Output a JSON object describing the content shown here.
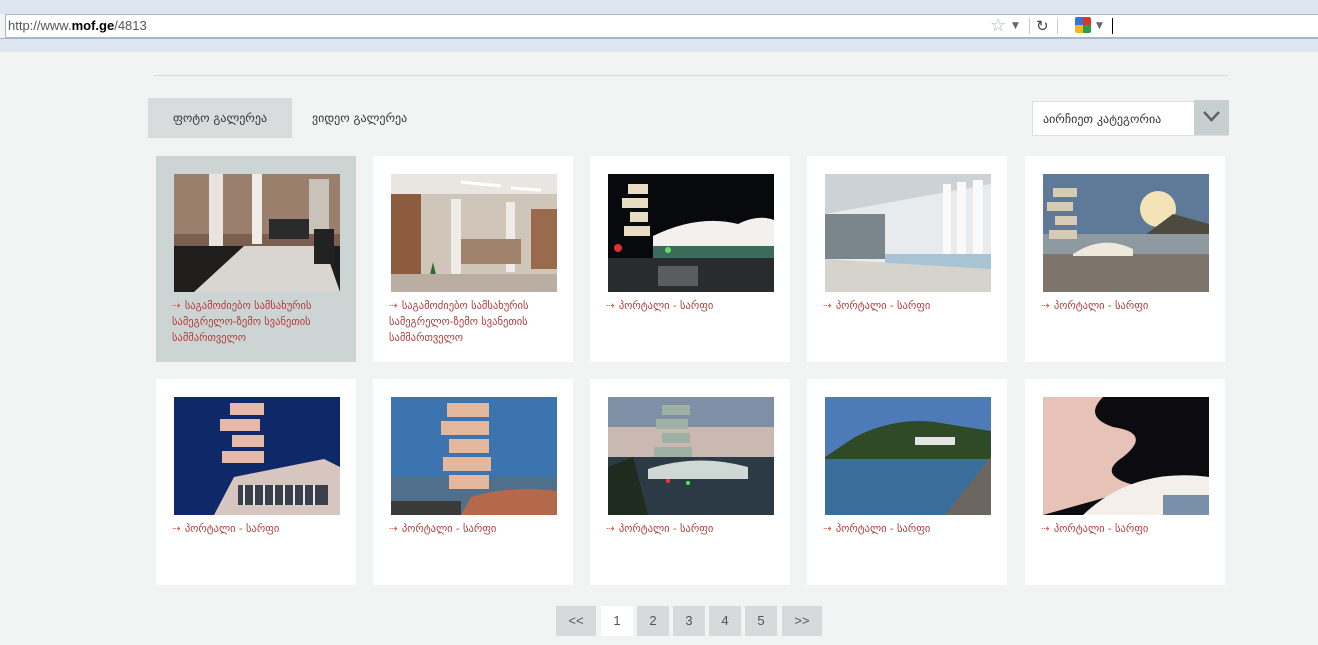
{
  "browser": {
    "url_prefix": "http://www.",
    "url_host": "mof.ge",
    "url_path": "/4813"
  },
  "tabs": {
    "photo": "ფოტო გალერეა",
    "video": "ვიდეო გალერეა"
  },
  "category": {
    "label": "აირჩიეთ კატეგორია"
  },
  "gallery": {
    "items": [
      {
        "caption": "საგამოძიებო სამსახურის სამეგრელო-ზემო სვანეთის სამმართველო",
        "image": "office-lobby"
      },
      {
        "caption": "საგამოძიებო სამსახურის სამეგრელო-ზემო სვანეთის სამმართველო",
        "image": "office-hall"
      },
      {
        "caption": "პორტალი - სარფი",
        "image": "night-building"
      },
      {
        "caption": "პორტალი - სარფი",
        "image": "canopy-sea"
      },
      {
        "caption": "პორტალი - სარფი",
        "image": "tower-coast"
      },
      {
        "caption": "პორტალი - სარფი",
        "image": "tower-night-blue"
      },
      {
        "caption": "პორტალი - სარფი",
        "image": "tower-dusk"
      },
      {
        "caption": "პორტალი - სარფი",
        "image": "tower-sunset"
      },
      {
        "caption": "პორტალი - სარფი",
        "image": "coastline"
      },
      {
        "caption": "პორტალი - სარფი",
        "image": "tower-closeup"
      }
    ]
  },
  "pagination": {
    "prev": "<<",
    "pages": [
      "1",
      "2",
      "3",
      "4",
      "5"
    ],
    "next": ">>",
    "current": "1"
  },
  "colors": {
    "caption": "#b23b3b",
    "active_tab": "#d8dcdc",
    "page_bg": "#f2f4f4"
  }
}
